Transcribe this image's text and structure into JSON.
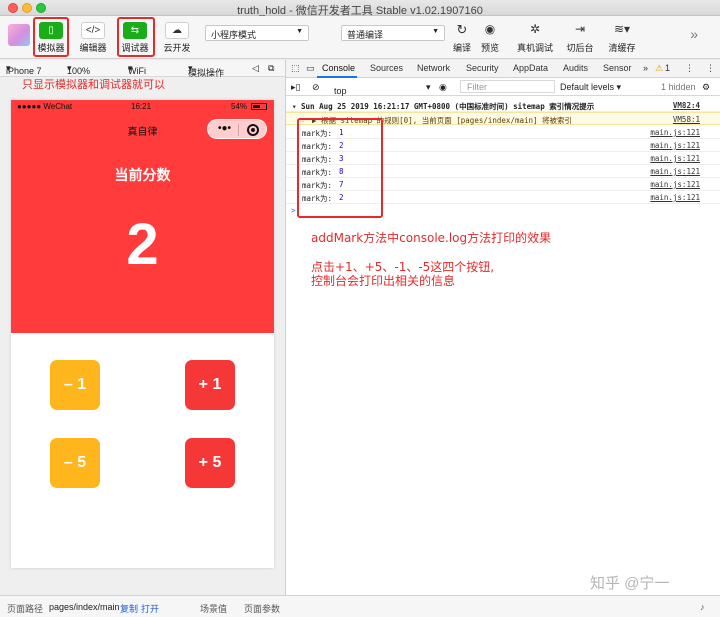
{
  "window": {
    "title": "truth_hold - 微信开发者工具 Stable v1.02.1907160"
  },
  "toolbar": {
    "simulator": "模拟器",
    "editor": "编辑器",
    "debugger": "调试器",
    "cloud": "云开发",
    "mode_select": "小程序模式",
    "compile_select": "普通编译",
    "compile": "编译",
    "preview": "预览",
    "device_debug": "真机调试",
    "background": "切后台",
    "clear_cache": "清缓存"
  },
  "simbar": {
    "device": "iPhone 7",
    "zoom": "100%",
    "network": "WiFi",
    "ops": "模拟操作"
  },
  "phone": {
    "carrier": "●●●●● WeChat",
    "time": "16:21",
    "battery": "54%",
    "nav_title": "真自律",
    "score_label": "当前分数",
    "score": "2",
    "buttons": [
      "– 1",
      "+ 1",
      "– 5",
      "+ 5"
    ]
  },
  "devtools": {
    "tabs": [
      "Console",
      "Sources",
      "Network",
      "Security",
      "AppData",
      "Audits",
      "Sensor",
      "»"
    ],
    "warning_count": "1",
    "context": "top",
    "filter_placeholder": "Filter",
    "levels": "Default levels ▾",
    "hidden": "1 hidden",
    "log_header": "▾ Sun Aug 25 2019 16:21:17 GMT+0800 (中国标准时间) sitemap 索引情况提示",
    "log_header_src": "VM82:4",
    "warning_text": "▶ 根据 sitemap 的规则[0], 当前页面 [pages/index/main] 将被索引",
    "warning_src": "VM58:1",
    "logs": [
      {
        "label": "mark为:",
        "value": "1",
        "src": "main.js:121"
      },
      {
        "label": "mark为:",
        "value": "2",
        "src": "main.js:121"
      },
      {
        "label": "mark为:",
        "value": "3",
        "src": "main.js:121"
      },
      {
        "label": "mark为:",
        "value": "8",
        "src": "main.js:121"
      },
      {
        "label": "mark为:",
        "value": "7",
        "src": "main.js:121"
      },
      {
        "label": "mark为:",
        "value": "2",
        "src": "main.js:121"
      }
    ],
    "prompt": ">"
  },
  "annotations": {
    "top": "只显示模拟器和调试器就可以",
    "console_line1": "addMark方法中console.log方法打印的效果",
    "console_line2": "点击+1、+5、-1、-5这四个按钮,",
    "console_line3": "控制台会打印出相关的信息"
  },
  "bottombar": {
    "path_label": "页面路径",
    "path": "pages/index/main",
    "copy": "复制",
    "open": "打开",
    "scene": "场景值",
    "params": "页面参数"
  },
  "watermark": "知乎 @宁一",
  "colors": {
    "accent_red": "#ff3b3b",
    "yellow_button": "#ffb51c",
    "red_button": "#f53737",
    "annotation_red": "#e32b2b",
    "wechat_green": "#1aad19"
  }
}
